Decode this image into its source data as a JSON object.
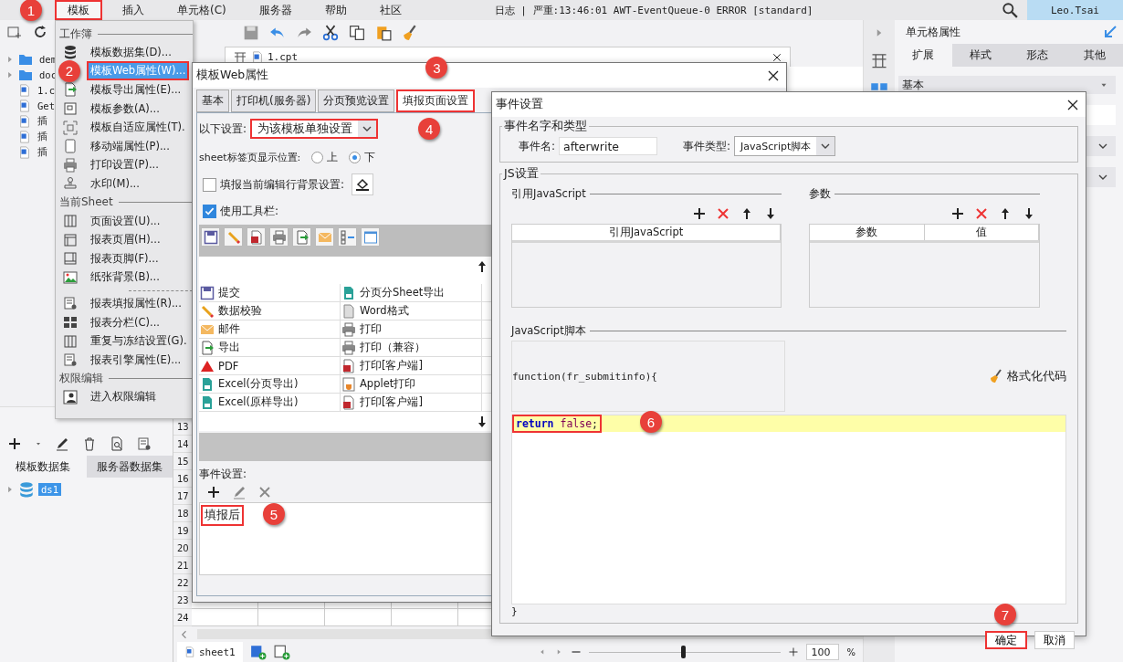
{
  "menubar": {
    "items": [
      {
        "label": "模板",
        "highlighted": true,
        "callout": "1"
      },
      {
        "label": "插入",
        "highlighted": false
      },
      {
        "label": "单元格(C)",
        "highlighted": false
      },
      {
        "label": "服务器",
        "highlighted": false
      },
      {
        "label": "帮助",
        "highlighted": false
      },
      {
        "label": "社区",
        "highlighted": false
      }
    ],
    "log": "日志 | 严重:13:46:01 AWT-EventQueue-0 ERROR [standard]",
    "user": "Leo.Tsai"
  },
  "file_tree": [
    {
      "label": "dem",
      "kind": "folder"
    },
    {
      "label": "doc",
      "kind": "folder"
    },
    {
      "label": "1.c",
      "kind": "file"
    },
    {
      "label": "Get",
      "kind": "file"
    },
    {
      "label": "插",
      "kind": "file"
    },
    {
      "label": "插",
      "kind": "file"
    },
    {
      "label": "插",
      "kind": "file"
    }
  ],
  "dataset_panel": {
    "tabs": [
      {
        "label": "模板数据集",
        "selected": true
      },
      {
        "label": "服务器数据集",
        "selected": false
      }
    ],
    "items": [
      {
        "label": "ds1",
        "selected": true
      }
    ]
  },
  "editor": {
    "tab": "1.cpt",
    "row_numbers": [
      "13",
      "14",
      "15",
      "16",
      "17",
      "18",
      "19",
      "20",
      "21",
      "22",
      "23",
      "24"
    ],
    "sheet_tab": "sheet1",
    "zoom": "100",
    "zoom_unit": "%",
    "zoom_slider": {
      "level": 0.49
    }
  },
  "cell_properties": {
    "title": "单元格属性",
    "tabs": [
      {
        "label": "扩展",
        "selected": true
      },
      {
        "label": "样式",
        "selected": false
      },
      {
        "label": "形态",
        "selected": false
      },
      {
        "label": "其他",
        "selected": false
      }
    ],
    "section": "基本"
  },
  "template_menu": {
    "sections": [
      {
        "title": "工作簿",
        "groups": [
          [
            {
              "label": "模板数据集(D)...",
              "highlighted": false
            },
            {
              "label": "模板Web属性(W)...",
              "highlighted": true,
              "callout": "2"
            },
            {
              "label": "模板导出属性(E)...",
              "highlighted": false
            },
            {
              "label": "模板参数(A)...",
              "highlighted": false
            },
            {
              "label": "模板自适应属性(T).",
              "highlighted": false
            },
            {
              "label": "移动端属性(P)...",
              "highlighted": false
            },
            {
              "label": "打印设置(P)...",
              "highlighted": false
            },
            {
              "label": "水印(M)...",
              "highlighted": false
            }
          ]
        ]
      },
      {
        "title": "当前Sheet",
        "groups": [
          [
            {
              "label": "页面设置(U)...",
              "highlighted": false
            },
            {
              "label": "报表页眉(H)...",
              "highlighted": false
            },
            {
              "label": "报表页脚(F)...",
              "highlighted": false
            },
            {
              "label": "纸张背景(B)...",
              "highlighted": false
            }
          ],
          [
            {
              "label": "报表填报属性(R)...",
              "highlighted": false
            },
            {
              "label": "报表分栏(C)...",
              "highlighted": false
            },
            {
              "label": "重复与冻结设置(G).",
              "highlighted": false
            },
            {
              "label": "报表引擎属性(E)...",
              "highlighted": false
            }
          ]
        ]
      },
      {
        "title": "权限编辑",
        "groups": [
          [
            {
              "label": "进入权限编辑",
              "highlighted": false
            }
          ]
        ]
      }
    ]
  },
  "web_dialog": {
    "title": "模板Web属性",
    "tabs": [
      {
        "label": "基本",
        "selected": false,
        "highlighted": false
      },
      {
        "label": "打印机(服务器)",
        "selected": false,
        "highlighted": false
      },
      {
        "label": "分页预览设置",
        "selected": false,
        "highlighted": false
      },
      {
        "label": "填报页面设置",
        "selected": true,
        "highlighted": true,
        "callout": "3"
      }
    ],
    "scope": {
      "label": "以下设置:",
      "value": "为该模板单独设置",
      "highlighted": true,
      "callout": "4"
    },
    "sheet_tab_position": {
      "label": "sheet标签页显示位置:",
      "options": [
        {
          "label": "上",
          "selected": false
        },
        {
          "label": "下",
          "selected": true
        }
      ]
    },
    "row_background": {
      "label": "填报当前编辑行背景设置:",
      "checked": false
    },
    "use_toolbar": {
      "label": "使用工具栏:",
      "checked": true
    },
    "button_columns": [
      {
        "items": [
          "提交",
          "数据校验",
          "邮件",
          "导出",
          "PDF",
          "Excel(分页导出)",
          "Excel(原样导出)"
        ]
      },
      {
        "items": [
          "分页分Sheet导出",
          "Word格式",
          "打印",
          "打印（兼容）",
          "打印[客户端]",
          "Applet打印",
          "打印[客户端]"
        ]
      }
    ],
    "events_label": "事件设置:",
    "events": [
      {
        "label": "填报后",
        "highlighted": true,
        "callout": "5"
      }
    ]
  },
  "event_dialog": {
    "title": "事件设置",
    "name_group": {
      "title": "事件名字和类型",
      "name_label": "事件名:",
      "name_value": "afterwrite",
      "type_label": "事件类型:",
      "type_value": "JavaScript脚本"
    },
    "js_group": {
      "title": "JS设置",
      "references": {
        "title": "引用JavaScript",
        "columns": [
          "引用JavaScript"
        ]
      },
      "params": {
        "title": "参数",
        "columns": [
          "参数",
          "值"
        ]
      },
      "script_label": "JavaScript脚本",
      "signature": "function(fr_submitinfo){",
      "format_button": "格式化代码",
      "code_lines": [
        {
          "tokens": [
            {
              "text": "return ",
              "kind": "keyword"
            },
            {
              "text": "false",
              "kind": "literal"
            },
            {
              "text": ";",
              "kind": "plain"
            }
          ],
          "highlighted": true,
          "callout": "6"
        }
      ],
      "closing": "}"
    },
    "buttons": [
      {
        "label": "确定",
        "highlighted": true,
        "callout": "7"
      },
      {
        "label": "取消",
        "highlighted": false
      }
    ]
  }
}
